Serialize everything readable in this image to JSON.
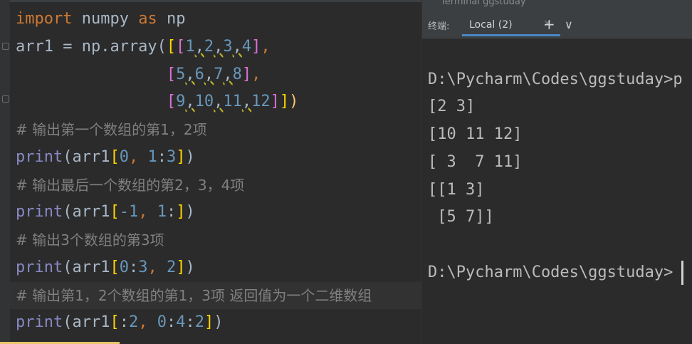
{
  "editor": {
    "lines": [
      {
        "type": "code",
        "tokens": [
          {
            "t": "import",
            "c": "kw"
          },
          {
            "t": " numpy ",
            "c": ""
          },
          {
            "t": "as",
            "c": "kw"
          },
          {
            "t": " np",
            "c": ""
          }
        ]
      },
      {
        "type": "code",
        "tokens": [
          {
            "t": "arr1 = np.array(",
            "c": ""
          },
          {
            "t": "[",
            "c": "b1"
          },
          {
            "t": "[",
            "c": "b2"
          },
          {
            "t": "1",
            "c": "num"
          },
          {
            "t": ",",
            "c": "hint"
          },
          {
            "t": "2",
            "c": "num"
          },
          {
            "t": ",",
            "c": "hint"
          },
          {
            "t": "3",
            "c": "num"
          },
          {
            "t": ",",
            "c": "hint"
          },
          {
            "t": "4",
            "c": "num"
          },
          {
            "t": "]",
            "c": "b2"
          },
          {
            "t": ",",
            "c": "sep"
          }
        ]
      },
      {
        "type": "code",
        "tokens": [
          {
            "t": "                ",
            "c": ""
          },
          {
            "t": "[",
            "c": "b2"
          },
          {
            "t": "5",
            "c": "num"
          },
          {
            "t": ",",
            "c": "hint"
          },
          {
            "t": "6",
            "c": "num"
          },
          {
            "t": ",",
            "c": "hint"
          },
          {
            "t": "7",
            "c": "num"
          },
          {
            "t": ",",
            "c": "hint"
          },
          {
            "t": "8",
            "c": "num"
          },
          {
            "t": "]",
            "c": "b2"
          },
          {
            "t": ",",
            "c": "sep"
          }
        ]
      },
      {
        "type": "code",
        "tokens": [
          {
            "t": "                ",
            "c": ""
          },
          {
            "t": "[",
            "c": "b2"
          },
          {
            "t": "9",
            "c": "num"
          },
          {
            "t": ",",
            "c": "hint"
          },
          {
            "t": "10",
            "c": "num"
          },
          {
            "t": ",",
            "c": "hint"
          },
          {
            "t": "11",
            "c": "num"
          },
          {
            "t": ",",
            "c": "hint"
          },
          {
            "t": "12",
            "c": "num"
          },
          {
            "t": "]",
            "c": "b2"
          },
          {
            "t": "]",
            "c": "b1"
          },
          {
            "t": ")",
            "c": "fn"
          }
        ]
      },
      {
        "type": "comment",
        "text": "# 输出第一个数组的第1，2项"
      },
      {
        "type": "code",
        "tokens": [
          {
            "t": "print",
            "c": "pr"
          },
          {
            "t": "(arr1",
            "c": ""
          },
          {
            "t": "[",
            "c": "b1"
          },
          {
            "t": "0",
            "c": "num"
          },
          {
            "t": ", ",
            "c": "sep"
          },
          {
            "t": "1",
            "c": "num"
          },
          {
            "t": ":",
            "c": ""
          },
          {
            "t": "3",
            "c": "num"
          },
          {
            "t": "]",
            "c": "b1"
          },
          {
            "t": ")",
            "c": ""
          }
        ]
      },
      {
        "type": "comment",
        "text": "# 输出最后一个数组的第2，3，4项"
      },
      {
        "type": "code",
        "tokens": [
          {
            "t": "print",
            "c": "pr"
          },
          {
            "t": "(arr1",
            "c": ""
          },
          {
            "t": "[",
            "c": "b1"
          },
          {
            "t": "-1",
            "c": "num"
          },
          {
            "t": ", ",
            "c": "sep"
          },
          {
            "t": "1",
            "c": "num"
          },
          {
            "t": ":",
            "c": ""
          },
          {
            "t": "]",
            "c": "b1"
          },
          {
            "t": ")",
            "c": ""
          }
        ]
      },
      {
        "type": "comment",
        "text": "# 输出3个数组的第3项"
      },
      {
        "type": "code",
        "tokens": [
          {
            "t": "print",
            "c": "pr"
          },
          {
            "t": "(arr1",
            "c": ""
          },
          {
            "t": "[",
            "c": "b1"
          },
          {
            "t": "0",
            "c": "num"
          },
          {
            "t": ":",
            "c": ""
          },
          {
            "t": "3",
            "c": "num"
          },
          {
            "t": ", ",
            "c": "sep"
          },
          {
            "t": "2",
            "c": "num"
          },
          {
            "t": "]",
            "c": "b1"
          },
          {
            "t": ")",
            "c": ""
          }
        ]
      },
      {
        "type": "comment",
        "text": "# 输出第1，2个数组的第1，3项 返回值为一个二维数组",
        "highlight": true
      },
      {
        "type": "code",
        "tokens": [
          {
            "t": "print",
            "c": "pr"
          },
          {
            "t": "(arr1",
            "c": ""
          },
          {
            "t": "[",
            "c": "b1"
          },
          {
            "t": ":",
            "c": ""
          },
          {
            "t": "2",
            "c": "num"
          },
          {
            "t": ", ",
            "c": "sep"
          },
          {
            "t": "0",
            "c": "num"
          },
          {
            "t": ":",
            "c": ""
          },
          {
            "t": "4",
            "c": "num"
          },
          {
            "t": ":",
            "c": ""
          },
          {
            "t": "2",
            "c": "num"
          },
          {
            "t": "]",
            "c": "b1"
          },
          {
            "t": ")",
            "c": ""
          }
        ]
      }
    ]
  },
  "terminal": {
    "title": "Terminal  ggstuday",
    "label": "终端:",
    "tab_label": "Local (2)",
    "tab_close": "×",
    "add_button": "+",
    "more_button": "∨",
    "output": [
      "",
      "D:\\Pycharm\\Codes\\ggstuday>p",
      "[2 3]",
      "[10 11 12]",
      "[ 3  7 11]",
      "[[1 3]",
      " [5 7]]",
      "",
      "D:\\Pycharm\\Codes\\ggstuday>"
    ]
  }
}
